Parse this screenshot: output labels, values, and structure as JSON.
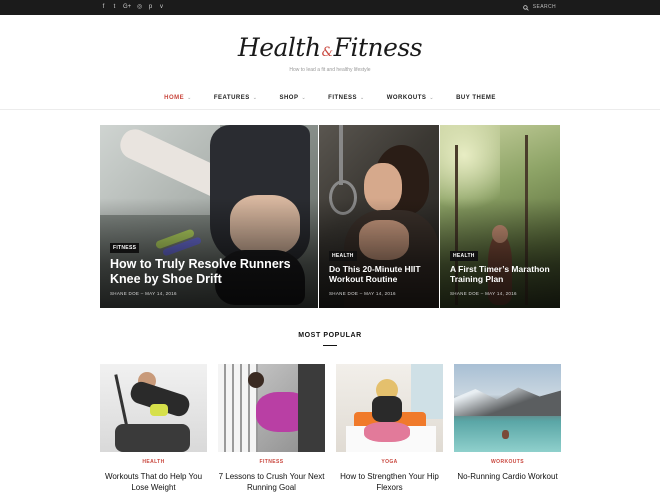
{
  "topbar": {
    "social": [
      {
        "icon": "facebook-icon",
        "glyph": "f"
      },
      {
        "icon": "twitter-icon",
        "glyph": "t"
      },
      {
        "icon": "google-plus-icon",
        "glyph": "G+"
      },
      {
        "icon": "instagram-icon",
        "glyph": "◎"
      },
      {
        "icon": "pinterest-icon",
        "glyph": "p"
      },
      {
        "icon": "vimeo-icon",
        "glyph": "v"
      }
    ],
    "search_label": "SEARCH"
  },
  "logo": {
    "part1": "Health",
    "amp": "&",
    "part2": "Fitness",
    "tagline": "How to lead a fit and healthy lifestyle"
  },
  "nav": {
    "home": "HOME",
    "features": "FEATURES",
    "shop": "SHOP",
    "fitness": "FITNESS",
    "workouts": "WORKOUTS",
    "buy_theme": "BUY THEME"
  },
  "featured": [
    {
      "category": "FITNESS",
      "title": "How to Truly Resolve Runners Knee by Shoe Drift",
      "meta": "SHANE DOE  –  MAY 14, 2016"
    },
    {
      "category": "HEALTH",
      "title": "Do This 20-Minute HIIT Workout Routine",
      "meta": "SHANE DOE  –  MAY 14, 2016"
    },
    {
      "category": "HEALTH",
      "title": "A First Timer’s Marathon Training Plan",
      "meta": "SHANE DOE  –  MAY 14, 2016"
    }
  ],
  "most_popular": {
    "heading": "MOST POPULAR",
    "items": [
      {
        "category": "HEALTH",
        "title": "Workouts That do Help You Lose Weight"
      },
      {
        "category": "FITNESS",
        "title": "7 Lessons to Crush Your Next Running Goal"
      },
      {
        "category": "YOGA",
        "title": "How to Strengthen Your Hip Flexors"
      },
      {
        "category": "WORKOUTS",
        "title": "No-Running Cardio Workout"
      }
    ]
  },
  "colors": {
    "accent": "#c9473e",
    "topbar": "#1b1b1b"
  }
}
